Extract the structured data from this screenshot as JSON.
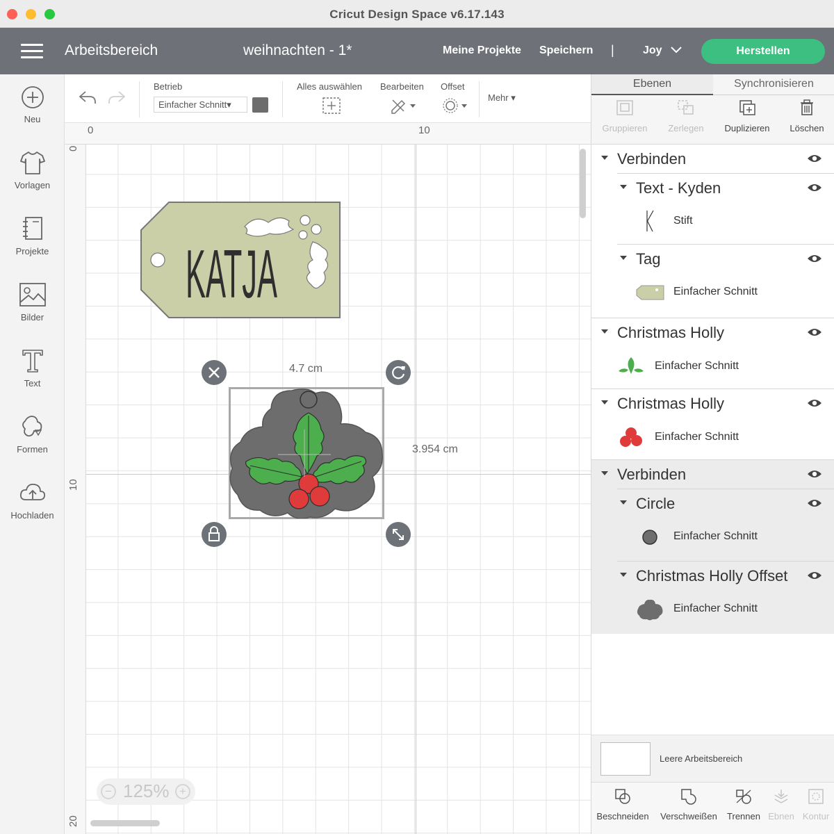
{
  "window": {
    "title": "Cricut Design Space  v6.17.143"
  },
  "header": {
    "workspace_title": "Arbeitsbereich",
    "project_title": "weihnachten - 1*",
    "nav_my_projects": "Meine Projekte",
    "nav_save": "Speichern",
    "separator": "|",
    "user_name": "Joy",
    "make_button": "Herstellen"
  },
  "sidebar": {
    "items": [
      {
        "label": "Neu",
        "icon": "plus-circle-icon"
      },
      {
        "label": "Vorlagen",
        "icon": "tshirt-icon"
      },
      {
        "label": "Projekte",
        "icon": "notebook-icon"
      },
      {
        "label": "Bilder",
        "icon": "image-icon"
      },
      {
        "label": "Text",
        "icon": "text-icon"
      },
      {
        "label": "Formen",
        "icon": "shapes-icon"
      },
      {
        "label": "Hochladen",
        "icon": "cloud-upload-icon"
      }
    ]
  },
  "toolbar": {
    "operation_label": "Betrieb",
    "operation_value": "Einfacher Schnitt",
    "operation_color": "#6d6d6d",
    "select_all_label": "Alles auswählen",
    "edit_label": "Bearbeiten",
    "offset_label": "Offset",
    "more_label": "Mehr"
  },
  "rulers": {
    "top": [
      "0",
      "10"
    ],
    "left": [
      "0",
      "10",
      "20"
    ]
  },
  "canvas": {
    "zoom": "125%",
    "tag_name_text": "KATJA",
    "selection_width": "4.7 cm",
    "selection_height": "3.954 cm",
    "tag_color": "#cbcfa8",
    "offset_color": "#6d6d6d",
    "holly_leaf_color": "#4cae4c",
    "berry_color": "#e03b3b"
  },
  "panel": {
    "tab_layers": "Ebenen",
    "tab_sync": "Synchronisieren",
    "tools": {
      "group": "Gruppieren",
      "ungroup": "Zerlegen",
      "duplicate": "Duplizieren",
      "delete": "Löschen"
    },
    "layers": {
      "g1_name": "Verbinden",
      "g1_sub1_name": "Text - Kyden",
      "g1_sub1_item": "Stift",
      "g1_sub2_name": "Tag",
      "g1_sub2_item": "Einfacher Schnitt",
      "g2_name": "Christmas Holly",
      "g2_item": "Einfacher Schnitt",
      "g3_name": "Christmas Holly",
      "g3_item": "Einfacher Schnitt",
      "g4_name": "Verbinden",
      "g4_sub1_name": "Circle",
      "g4_sub1_item": "Einfacher Schnitt",
      "g4_sub2_name": "Christmas Holly Offset",
      "g4_sub2_item": "Einfacher Schnitt"
    },
    "blank_canvas_label": "Leere Arbeitsbereich",
    "bottom_tools": {
      "slice": "Beschneiden",
      "weld": "Verschweißen",
      "detach": "Trennen",
      "flatten": "Ebnen",
      "contour": "Kontur"
    }
  }
}
